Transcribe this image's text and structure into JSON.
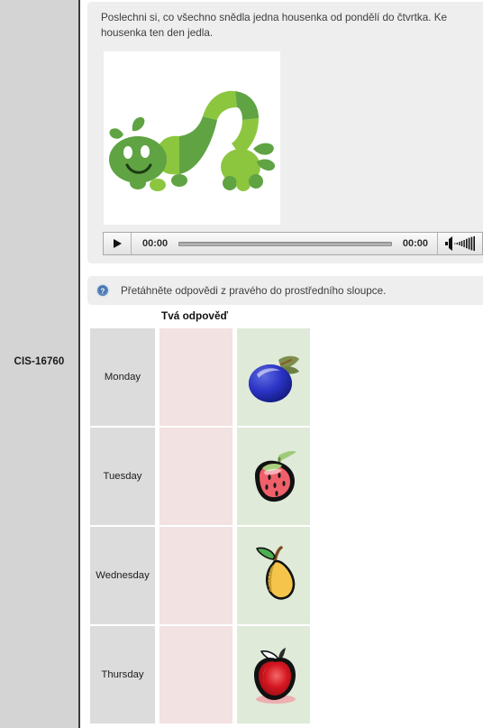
{
  "sidebar": {
    "item_id": "CIS-16760"
  },
  "stimulus": {
    "prompt": "Poslechni si, co všechno snědla jedna housenka od pondělí do čtvrtka. Ke\nhousenka ten den jedla.",
    "illustration_name": "caterpillar-illustration"
  },
  "player": {
    "play_label": "play-icon",
    "current_time": "00:00",
    "total_time": "00:00",
    "volume_label": "volume-icon"
  },
  "instruction": {
    "icon": "help-icon",
    "text": "Přetáhněte odpovědi z pravého do prostředního sloupce."
  },
  "table": {
    "answer_column_header": "Tvá odpověď",
    "rows": [
      {
        "day": "Monday",
        "answer": "",
        "option_icon": "plum-icon"
      },
      {
        "day": "Tuesday",
        "answer": "",
        "option_icon": "strawberry-icon"
      },
      {
        "day": "Wednesday",
        "answer": "",
        "option_icon": "pear-icon"
      },
      {
        "day": "Thursday",
        "answer": "",
        "option_icon": "apple-icon"
      }
    ]
  },
  "colors": {
    "sidebar_bg": "#d4d4d4",
    "panel_bg": "#eeeeee",
    "day_cell_bg": "#dcdcdc",
    "answer_cell_bg": "#f2e2e1",
    "option_cell_bg": "#dfead9",
    "caterpillar_green_dark": "#5fa343",
    "caterpillar_green_light": "#8cc63f"
  }
}
